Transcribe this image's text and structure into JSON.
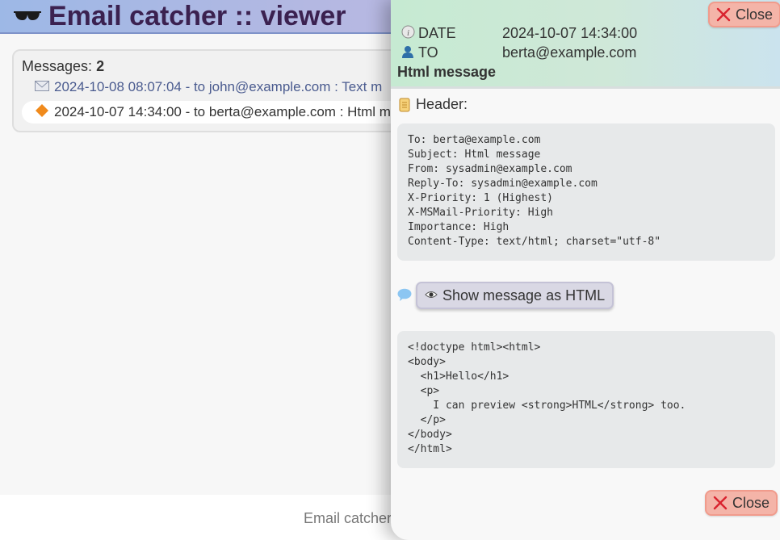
{
  "app": {
    "title": "Email catcher :: viewer",
    "footer": "Email catcher"
  },
  "list": {
    "count_label": "Messages:",
    "count": "2",
    "items": [
      {
        "text": "2024-10-08 08:07:04 - to john@example.com : Text m",
        "icon": "envelope-icon"
      },
      {
        "text": "2024-10-07 14:34:00 - to berta@example.com : Html m",
        "icon": "diamond-icon"
      }
    ]
  },
  "panel": {
    "close_label": "Close",
    "date_label": "DATE",
    "date_value": "2024-10-07 14:34:00",
    "to_label": "TO",
    "to_value": "berta@example.com",
    "subject": "Html message",
    "header_label": "Header:",
    "headers_text": "To: berta@example.com\nSubject: Html message\nFrom: sysadmin@example.com\nReply-To: sysadmin@example.com\nX-Priority: 1 (Highest)\nX-MSMail-Priority: High\nImportance: High\nContent-Type: text/html; charset=\"utf-8\"",
    "show_html_label": "Show message as HTML",
    "body_text": "<!doctype html><html>\n<body>\n  <h1>Hello</h1>\n  <p>\n    I can preview <strong>HTML</strong> too.\n  </p>\n</body>\n</html>"
  },
  "colors": {
    "accent": "#3b2150",
    "close": "#f4b4a8",
    "close_x": "#d9242f",
    "link": "#4a5b8f"
  }
}
